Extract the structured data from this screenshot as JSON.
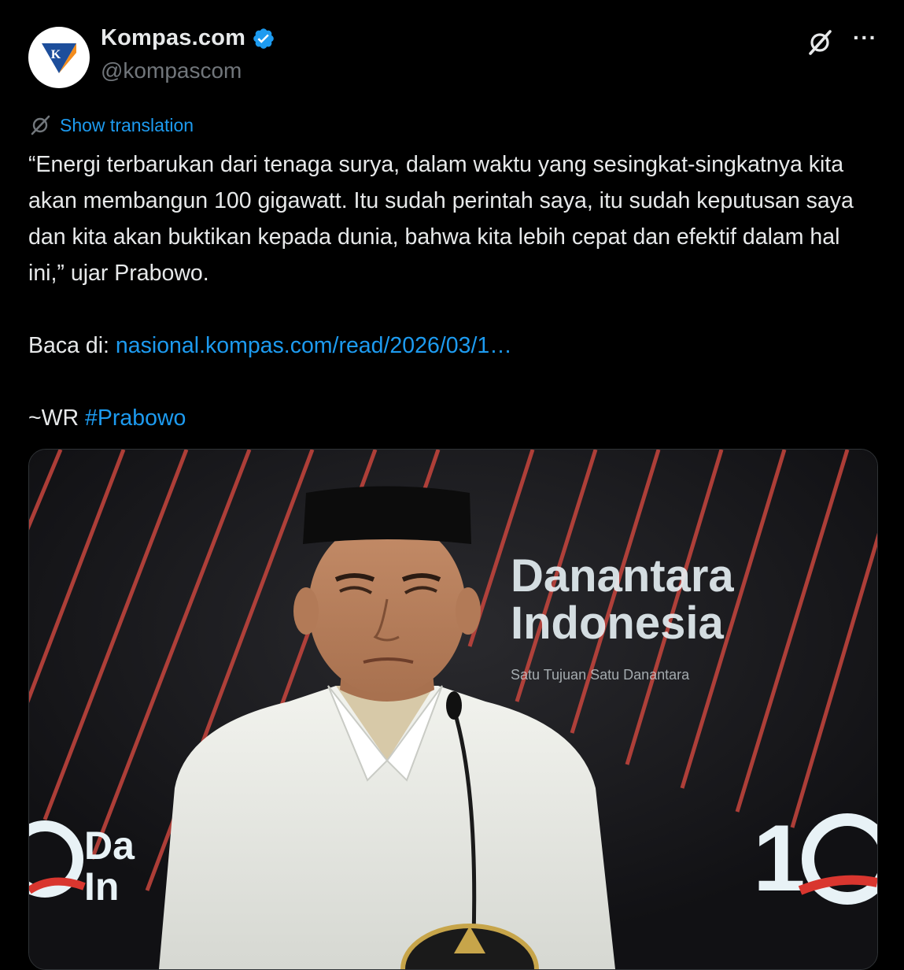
{
  "account": {
    "display_name": "Kompas.com",
    "handle": "@kompascom",
    "verified": true,
    "avatar_letter": "K"
  },
  "actions": {
    "grok_icon": "grok-icon",
    "more_label": "···"
  },
  "translation": {
    "label": "Show translation",
    "icon": "translate-icon"
  },
  "tweet": {
    "quote": "“Energi terbarukan dari tenaga surya, dalam waktu yang sesingkat-singkatnya kita akan membangun 100 gigawatt. Itu sudah perintah saya, itu sudah keputusan saya dan kita akan buktikan kepada dunia, bahwa kita lebih cepat dan efektif dalam hal ini,” ujar Prabowo.",
    "read_prefix": "Baca di: ",
    "read_link": "nasional.kompas.com/read/2026/03/1…",
    "sign_prefix": "~WR ",
    "hashtag": "#Prabowo"
  },
  "media": {
    "backdrop_line1": "Danantara",
    "backdrop_line2": "Indonesia",
    "backdrop_tagline": "Satu Tujuan Satu Danantara",
    "side_text_left": "Da",
    "side_text_left2": "In",
    "side_badge_right": "1",
    "colors": {
      "stripe": "#d9362f",
      "backdrop": "#141416",
      "text": "#e8f2f6"
    }
  },
  "colors": {
    "background": "#000000",
    "text": "#e7e9ea",
    "muted": "#71767b",
    "link": "#1d9bf0",
    "verified": "#1d9bf0",
    "kompas_blue": "#1d4e9b",
    "kompas_orange": "#f28c1e"
  }
}
